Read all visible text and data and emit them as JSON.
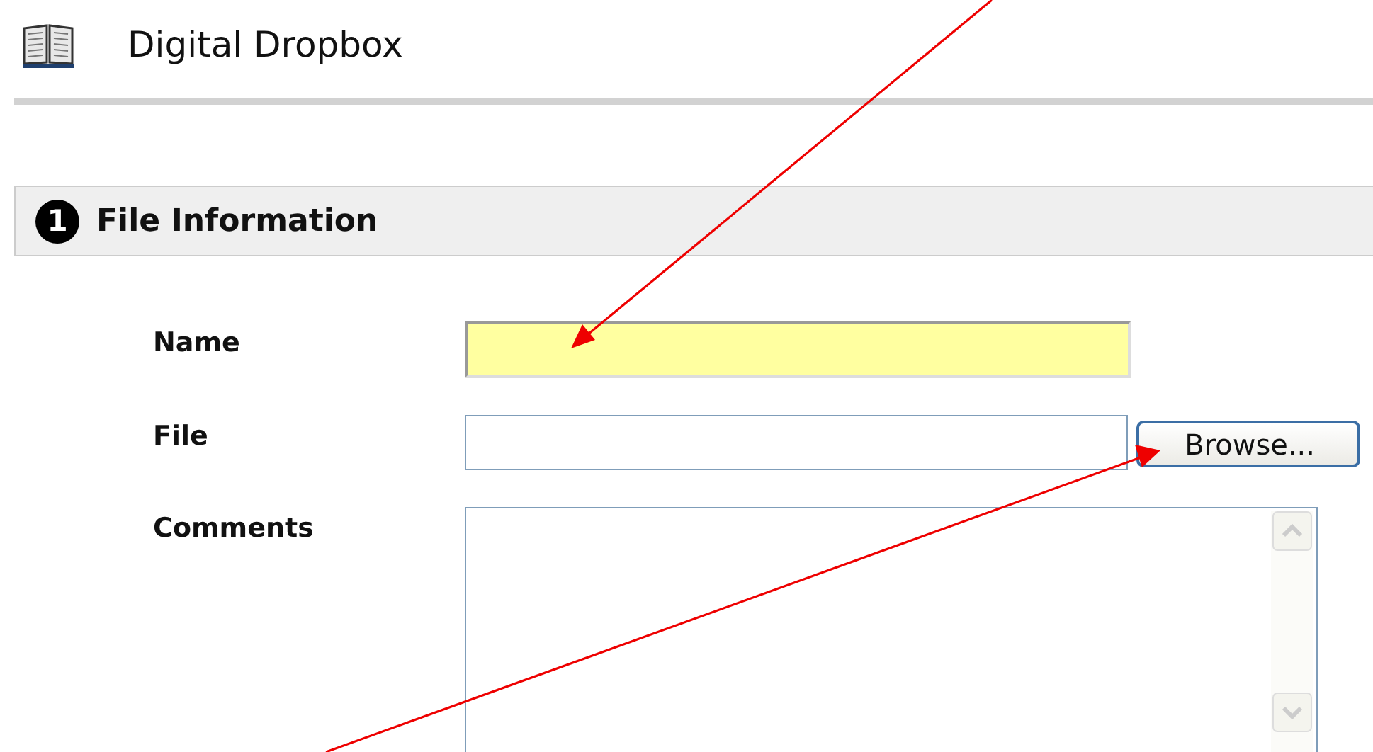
{
  "page": {
    "title": "Digital Dropbox"
  },
  "section": {
    "number": "1",
    "title": "File Information"
  },
  "fields": [
    {
      "kind": "text",
      "label": "Name",
      "highlighted": true
    },
    {
      "kind": "file",
      "label": "File",
      "highlighted": false,
      "button": "Browse..."
    },
    {
      "kind": "textarea",
      "label": "Comments",
      "highlighted": false
    }
  ]
}
